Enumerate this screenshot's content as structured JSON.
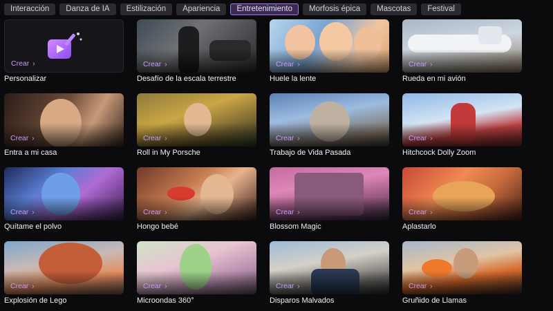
{
  "tabs": [
    {
      "label": "Interacción",
      "active": false
    },
    {
      "label": "Danza de IA",
      "active": false
    },
    {
      "label": "Estilización",
      "active": false
    },
    {
      "label": "Apariencia",
      "active": false
    },
    {
      "label": "Entretenimiento",
      "active": true
    },
    {
      "label": "Morfosis épica",
      "active": false
    },
    {
      "label": "Mascotas",
      "active": false
    },
    {
      "label": "Festival",
      "active": false
    }
  ],
  "crear_label": "Crear",
  "cards": [
    {
      "label": "Personalizar"
    },
    {
      "label": "Desafío de la escala terrestre"
    },
    {
      "label": "Huele la lente"
    },
    {
      "label": "Rueda en mi avión"
    },
    {
      "label": "Entra a mi casa"
    },
    {
      "label": "Roll in My Porsche"
    },
    {
      "label": "Trabajo de Vida Pasada"
    },
    {
      "label": "Hitchcock Dolly Zoom"
    },
    {
      "label": "Quítame el polvo"
    },
    {
      "label": "Hongo bebé"
    },
    {
      "label": "Blossom Magic"
    },
    {
      "label": "Aplastarlo"
    },
    {
      "label": "Explosión de Lego"
    },
    {
      "label": "Microondas 360°"
    },
    {
      "label": "Disparos Malvados"
    },
    {
      "label": "Gruñido de Llamas"
    }
  ],
  "colors": {
    "accent": "#a47cf0",
    "crear": "#c89cff"
  },
  "icons": {
    "personalizar": "video-magic-wand-icon",
    "crear_arrow": "chevron-right-icon"
  }
}
